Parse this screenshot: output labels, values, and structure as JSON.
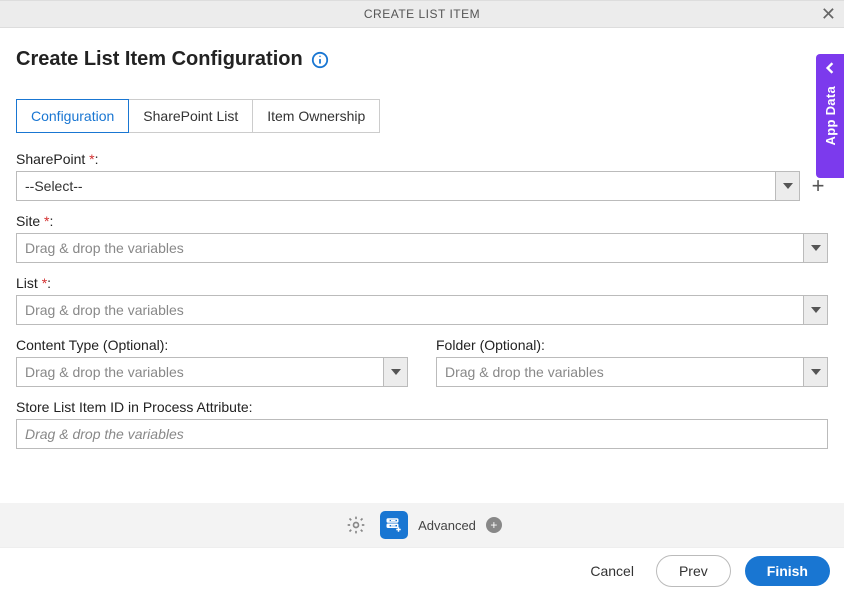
{
  "header": {
    "title": "CREATE LIST ITEM"
  },
  "page": {
    "title": "Create List Item Configuration"
  },
  "tabs": {
    "configuration": "Configuration",
    "sharepoint_list": "SharePoint List",
    "item_ownership": "Item Ownership"
  },
  "form": {
    "sharepoint": {
      "label": "SharePoint",
      "required": "*",
      "colon": ":",
      "value": "--Select--"
    },
    "site": {
      "label": "Site",
      "required": "*",
      "colon": ":",
      "placeholder": "Drag & drop the variables"
    },
    "list": {
      "label": "List",
      "required": "*",
      "colon": ":",
      "placeholder": "Drag & drop the variables"
    },
    "content_type": {
      "label": "Content Type (Optional):",
      "placeholder": "Drag & drop the variables"
    },
    "folder": {
      "label": "Folder (Optional):",
      "placeholder": "Drag & drop the variables"
    },
    "store_id": {
      "label": "Store List Item ID in Process Attribute:",
      "placeholder": "Drag & drop the variables"
    }
  },
  "side_tab": {
    "label": "App Data"
  },
  "bottom": {
    "advanced": "Advanced"
  },
  "footer": {
    "cancel": "Cancel",
    "prev": "Prev",
    "finish": "Finish"
  }
}
